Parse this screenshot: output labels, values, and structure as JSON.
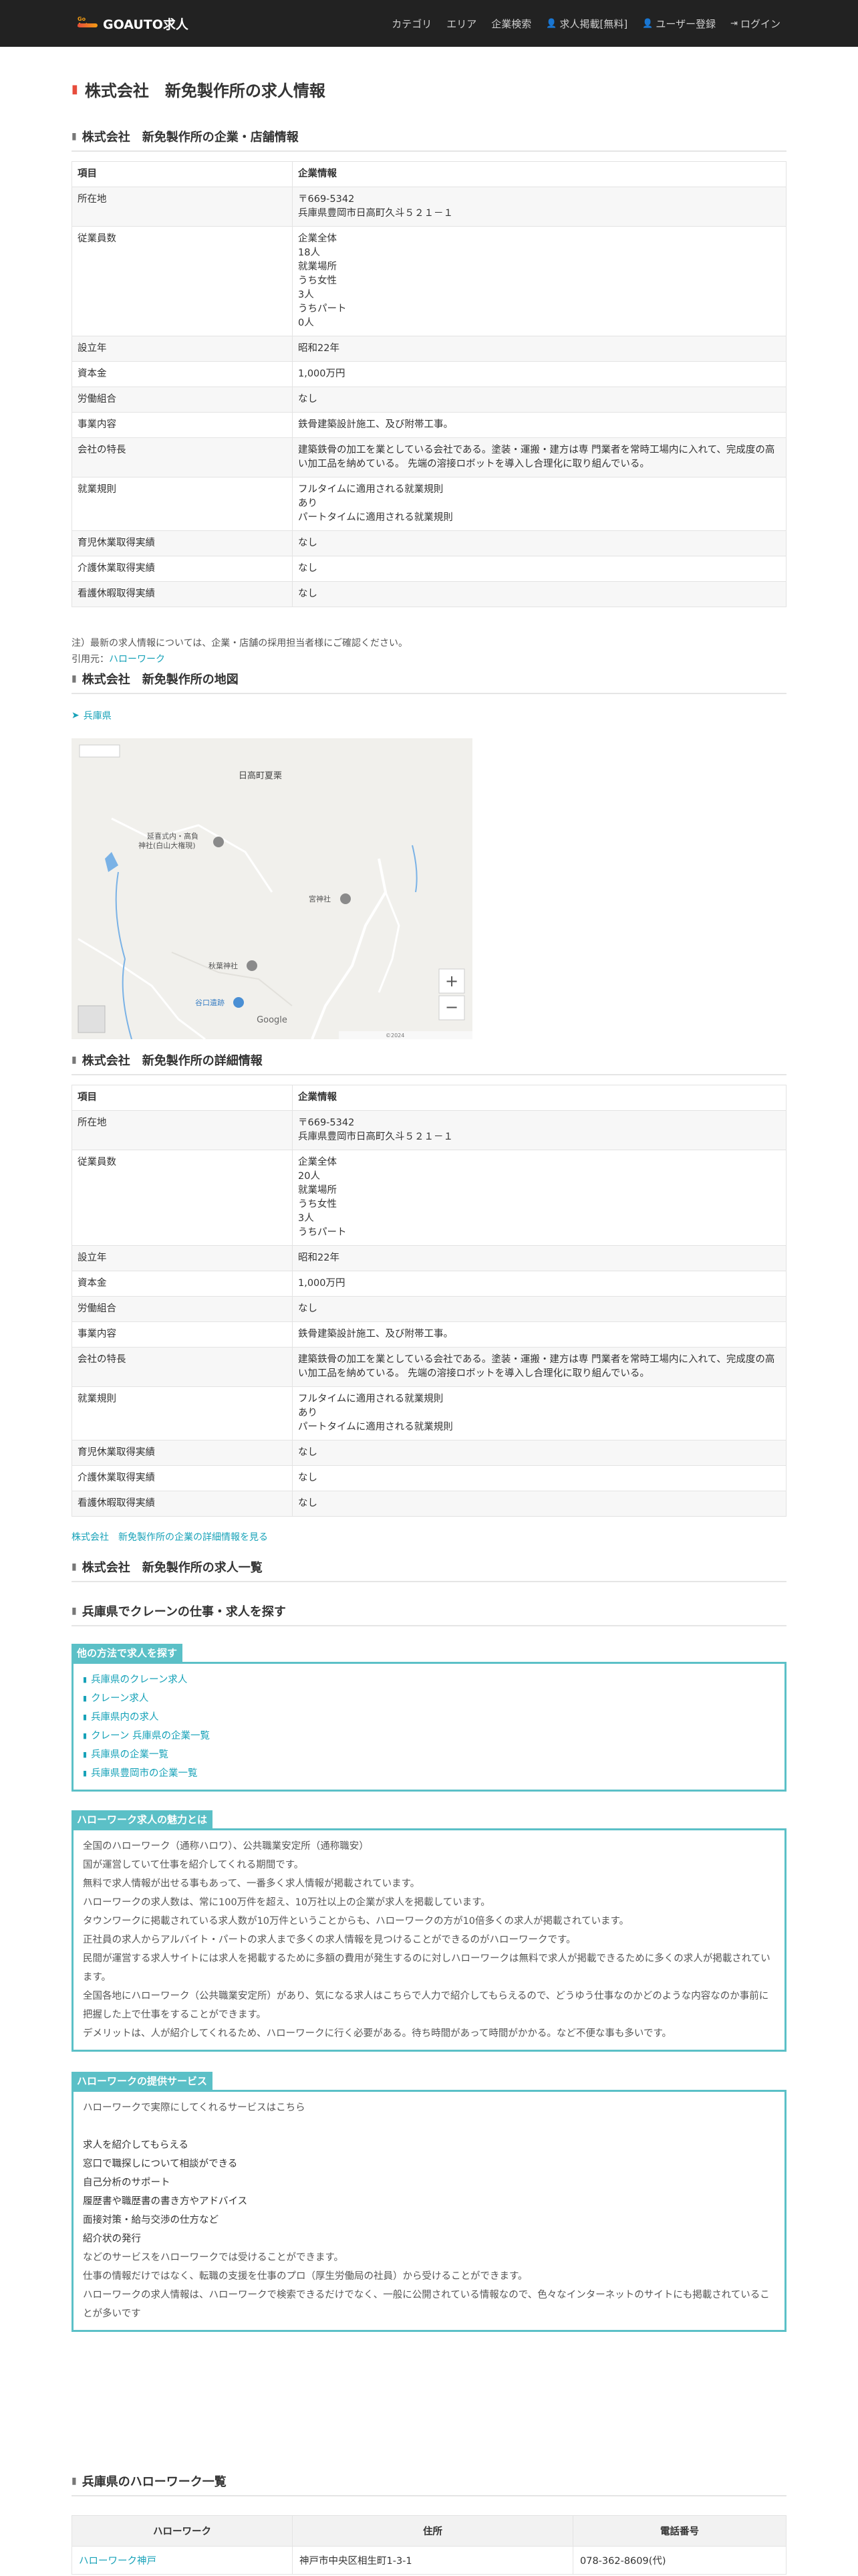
{
  "nav": {
    "brand": "GOAUTO求人",
    "logo_small": "Go Auto",
    "links": [
      "カテゴリ",
      "エリア",
      "企業検索",
      "求人掲載[無料]",
      "ユーザー登録",
      "ログイン"
    ]
  },
  "page_title": "株式会社　新免製作所の求人情報",
  "store_section": {
    "title": "株式会社　新免製作所の企業・店舗情報",
    "head_key": "項目",
    "head_val": "企業情報",
    "rows": [
      {
        "k": "所在地",
        "v": [
          "〒669-5342",
          "兵庫県豊岡市日高町久斗５２１－１"
        ]
      },
      {
        "k": "従業員数",
        "v": [
          "企業全体",
          "18人",
          "就業場所",
          "うち女性",
          "3人",
          "うちパート",
          "0人"
        ]
      },
      {
        "k": "設立年",
        "v": [
          "昭和22年"
        ]
      },
      {
        "k": "資本金",
        "v": [
          "1,000万円"
        ]
      },
      {
        "k": "労働組合",
        "v": [
          "なし"
        ]
      },
      {
        "k": "事業内容",
        "v": [
          "鉄骨建築設計施工、及び附帯工事。"
        ]
      },
      {
        "k": "会社の特長",
        "v": [
          "建築鉄骨の加工を業としている会社である。塗装・運搬・建方は専 門業者を常時工場内に入れて、完成度の高い加工品を納めている。 先端の溶接ロボットを導入し合理化に取り組んでいる。"
        ]
      },
      {
        "k": "就業規則",
        "v": [
          "フルタイムに適用される就業規則",
          "あり",
          "パートタイムに適用される就業規則"
        ]
      },
      {
        "k": "育児休業取得実績",
        "v": [
          "なし"
        ]
      },
      {
        "k": "介護休業取得実績",
        "v": [
          "なし"
        ]
      },
      {
        "k": "看護休暇取得実績",
        "v": [
          "なし"
        ]
      }
    ]
  },
  "notes": {
    "line1": "注）最新の求人情報については、企業・店舗の採用担当者様にご確認ください。",
    "source_label": "引用元：",
    "source_link": "ハローワーク"
  },
  "map_section": {
    "title": "株式会社　新免製作所の地図",
    "location": "兵庫県",
    "labels": {
      "area1": "日高町夏栗",
      "temple": "延喜式内・高負",
      "temple2": "神社(白山大権現)",
      "shrine1": "宮神社",
      "shrine2": "秋葉神社",
      "ruins": "谷口遺跡",
      "google": "Google",
      "attribution": "©2024"
    }
  },
  "detail_section": {
    "title": "株式会社　新免製作所の詳細情報",
    "head_key": "項目",
    "head_val": "企業情報",
    "rows": [
      {
        "k": "所在地",
        "v": [
          "〒669-5342",
          "兵庫県豊岡市日高町久斗５２１－１"
        ]
      },
      {
        "k": "従業員数",
        "v": [
          "企業全体",
          "20人",
          "就業場所",
          "うち女性",
          "3人",
          "うちパート"
        ]
      },
      {
        "k": "設立年",
        "v": [
          "昭和22年"
        ]
      },
      {
        "k": "資本金",
        "v": [
          "1,000万円"
        ]
      },
      {
        "k": "労働組合",
        "v": [
          "なし"
        ]
      },
      {
        "k": "事業内容",
        "v": [
          "鉄骨建築設計施工、及び附帯工事。"
        ]
      },
      {
        "k": "会社の特長",
        "v": [
          "建築鉄骨の加工を業としている会社である。塗装・運搬・建方は専 門業者を常時工場内に入れて、完成度の高い加工品を納めている。 先端の溶接ロボットを導入し合理化に取り組んでいる。"
        ]
      },
      {
        "k": "就業規則",
        "v": [
          "フルタイムに適用される就業規則",
          "あり",
          "パートタイムに適用される就業規則"
        ]
      },
      {
        "k": "育児休業取得実績",
        "v": [
          "なし"
        ]
      },
      {
        "k": "介護休業取得実績",
        "v": [
          "なし"
        ]
      },
      {
        "k": "看護休暇取得実績",
        "v": [
          "なし"
        ]
      }
    ],
    "more_link": "株式会社　新免製作所の企業の詳細情報を見る"
  },
  "jobs_section": {
    "title": "株式会社　新免製作所の求人一覧"
  },
  "search_section": {
    "title": "兵庫県でクレーンの仕事・求人を探す",
    "box_title": "他の方法で求人を探す",
    "links": [
      "兵庫県のクレーン求人",
      "クレーン求人",
      "兵庫県内の求人",
      "クレーン 兵庫県の企業一覧",
      "兵庫県の企業一覧",
      "兵庫県豊岡市の企業一覧"
    ]
  },
  "appeal": {
    "title": "ハローワーク求人の魅力とは",
    "lines": [
      "全国のハローワーク（通称ハロワ）、公共職業安定所（通称職安）",
      "国が運営していて仕事を紹介してくれる期間です。",
      "無料で求人情報が出せる事もあって、一番多く求人情報が掲載されています。",
      "ハローワークの求人数は、常に100万件を超え、10万社以上の企業が求人を掲載しています。",
      "タウンワークに掲載されている求人数が10万件ということからも、ハローワークの方が10倍多くの求人が掲載されています。",
      "正社員の求人からアルバイト・パートの求人まで多くの求人情報を見つけることができるのがハローワークです。",
      "民間が運営する求人サイトには求人を掲載するために多額の費用が発生するのに対しハローワークは無料で求人が掲載できるために多くの求人が掲載されています。",
      "全国各地にハローワーク（公共職業安定所）があり、気になる求人はこちらで人力で紹介してもらえるので、どうゆう仕事なのかどのような内容なのか事前に把握した上で仕事をすることができます。",
      "デメリットは、人が紹介してくれるため、ハローワークに行く必要がある。待ち時間があって時間がかかる。など不便な事も多いです。"
    ]
  },
  "services": {
    "title": "ハローワークの提供サービス",
    "intro": "ハローワークで実際にしてくれるサービスはこちら",
    "items": [
      "求人を紹介してもらえる",
      "窓口で職探しについて相談ができる",
      "自己分析のサポート",
      "履歴書や職歴書の書き方やアドバイス",
      "面接対策・給与交渉の仕方など",
      "紹介状の発行"
    ],
    "tail": [
      "などのサービスをハローワークでは受けることができます。",
      "仕事の情報だけではなく、転職の支援を仕事のプロ（厚生労働局の社員）から受けることができます。",
      "ハローワークの求人情報は、ハローワークで検索できるだけでなく、一般に公開されている情報なので、色々なインターネットのサイトにも掲載されていることが多いです"
    ]
  },
  "hw_list": {
    "title": "兵庫県のハローワーク一覧",
    "headers": [
      "ハローワーク",
      "住所",
      "電話番号"
    ],
    "row": [
      "ハローワーク神戸",
      "神戸市中央区相生町1-3-1",
      "078-362-8609(代)"
    ]
  },
  "colors": {
    "accent": "#17a2b8",
    "box": "#5bc0c7",
    "navbar": "#222222",
    "title_icon": "#e74c3c"
  }
}
